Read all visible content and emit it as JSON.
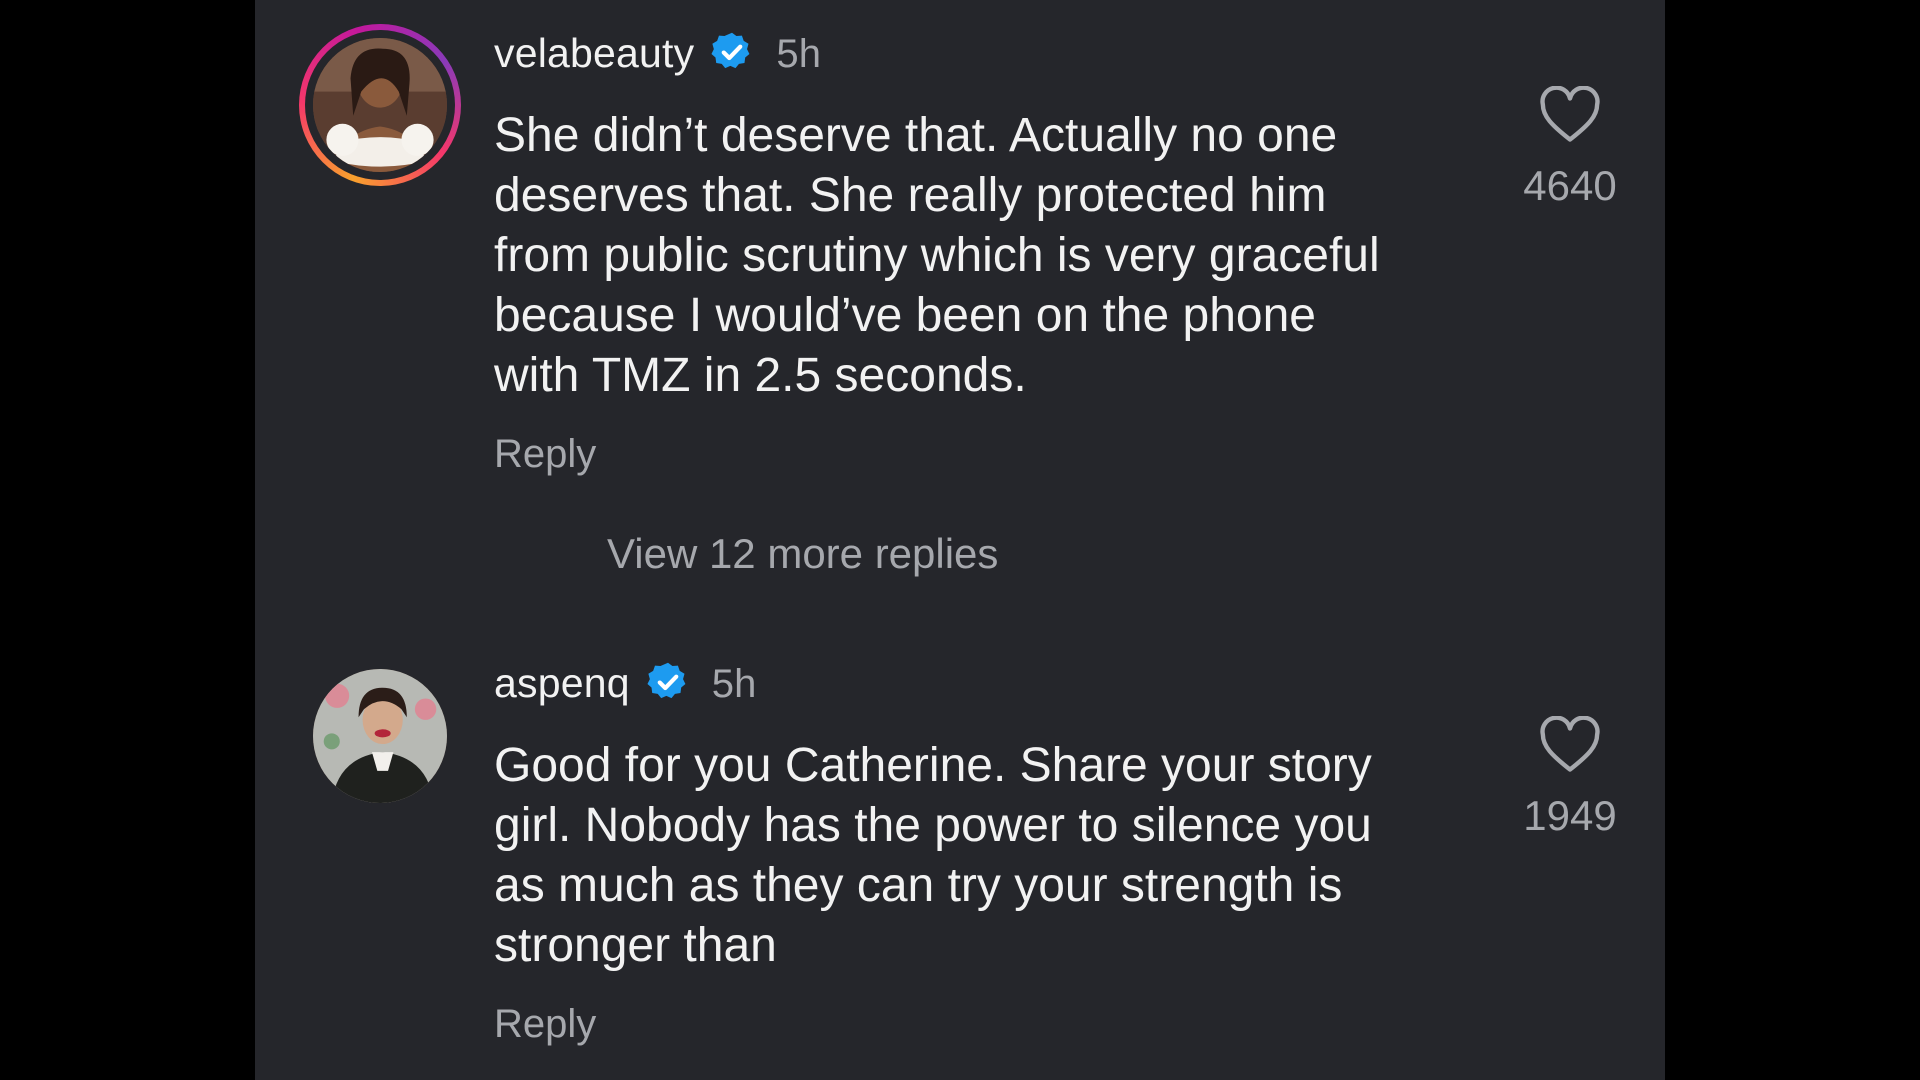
{
  "comments": [
    {
      "username": "velabeauty",
      "time": "5h",
      "body": "She didn’t deserve that. Actually no one\ndeserves that. She really protected him\nfrom public scrutiny which is very graceful\nbecause I would’ve been on the phone\nwith TMZ in 2.5 seconds.",
      "reply_label": "Reply",
      "likes": "4640"
    },
    {
      "username": "aspenq",
      "time": "5h",
      "body": "Good for you Catherine. Share your story\ngirl. Nobody has the power to silence you\nas much as they can try your strength is\nstronger than",
      "reply_label": "Reply",
      "likes": "1949"
    }
  ],
  "view_more_replies": "View 12 more replies",
  "colors": {
    "background": "#25262b",
    "text_primary": "#f2f2f2",
    "text_secondary": "#a6a8ad",
    "verified": "#1d9bf0",
    "letterbox": "#000000"
  },
  "icons": [
    "verified-badge-icon",
    "heart-icon"
  ]
}
